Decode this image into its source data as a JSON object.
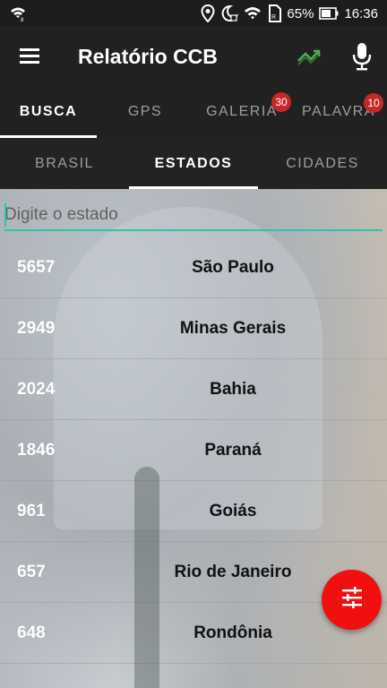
{
  "status_bar": {
    "battery_percent": "65%",
    "time": "16:36",
    "icons": [
      "wifi-calling-icon",
      "location-icon",
      "do-not-disturb-icon",
      "wifi-icon",
      "sim-icon",
      "battery-icon"
    ]
  },
  "app_bar": {
    "title": "Relatório CCB",
    "icons": [
      "menu-icon",
      "trending-icon",
      "microphone-icon"
    ],
    "accent_color": "#4caf50"
  },
  "tabs": [
    {
      "label": "BUSCA",
      "active": true
    },
    {
      "label": "GPS",
      "active": false
    },
    {
      "label": "GALERIA",
      "badge": "30",
      "active": false
    },
    {
      "label": "PALAVRA",
      "badge": "10",
      "active": false
    }
  ],
  "subtabs": [
    {
      "label": "BRASIL",
      "active": false
    },
    {
      "label": "ESTADOS",
      "active": true
    },
    {
      "label": "CIDADES",
      "active": false
    }
  ],
  "search": {
    "placeholder": "Digite o estado",
    "value": ""
  },
  "states": [
    {
      "count": "5657",
      "name": "São Paulo"
    },
    {
      "count": "2949",
      "name": "Minas Gerais"
    },
    {
      "count": "2024",
      "name": "Bahia"
    },
    {
      "count": "1846",
      "name": "Paraná"
    },
    {
      "count": "961",
      "name": "Goiás"
    },
    {
      "count": "657",
      "name": "Rio de Janeiro"
    },
    {
      "count": "648",
      "name": "Rondônia"
    }
  ],
  "fab": {
    "icon": "filter-sliders-icon",
    "color": "#f01010"
  },
  "colors": {
    "toolbar": "#212121",
    "search_underline": "#26c6b0",
    "badge": "#c62828"
  }
}
